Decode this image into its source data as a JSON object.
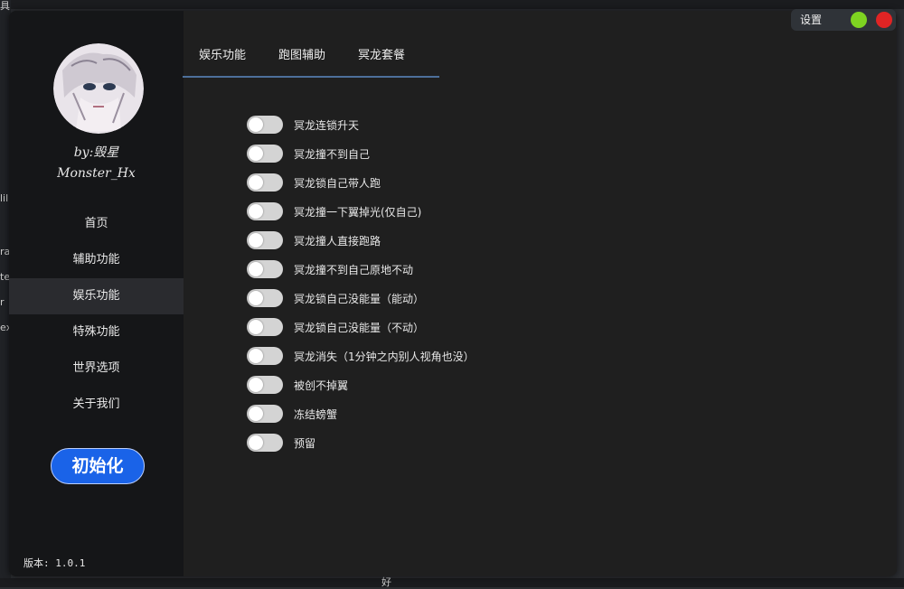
{
  "background": {
    "snippets": [
      "具",
      "lil",
      "ra",
      "te",
      "r",
      "ex",
      "好"
    ]
  },
  "sidebar": {
    "author_line1": "by:毁星",
    "author_line2": "Monster_Hx",
    "nav": [
      {
        "label": "首页"
      },
      {
        "label": "辅助功能"
      },
      {
        "label": "娱乐功能"
      },
      {
        "label": "特殊功能"
      },
      {
        "label": "世界选项"
      },
      {
        "label": "关于我们"
      }
    ],
    "active_index": 2,
    "init_button": "初始化",
    "version": "版本: 1.0.1"
  },
  "tabs": [
    {
      "label": "娱乐功能"
    },
    {
      "label": "跑图辅助"
    },
    {
      "label": "冥龙套餐"
    }
  ],
  "toggles": [
    {
      "label": "冥龙连锁升天",
      "on": false
    },
    {
      "label": "冥龙撞不到自己",
      "on": false
    },
    {
      "label": "冥龙锁自己带人跑",
      "on": false
    },
    {
      "label": "冥龙撞一下翼掉光(仅自己)",
      "on": false
    },
    {
      "label": "冥龙撞人直接跑路",
      "on": false
    },
    {
      "label": "冥龙撞不到自己原地不动",
      "on": false
    },
    {
      "label": "冥龙锁自己没能量（能动）",
      "on": false
    },
    {
      "label": "冥龙锁自己没能量（不动）",
      "on": false
    },
    {
      "label": "冥龙消失（1分钟之内别人视角也没）",
      "on": false
    },
    {
      "label": "被创不掉翼",
      "on": false
    },
    {
      "label": "冻结螃蟹",
      "on": false
    },
    {
      "label": "预留",
      "on": false
    }
  ],
  "controls": {
    "settings_label": "设置",
    "green_color": "#7ed321",
    "red_color": "#e02424"
  },
  "colors": {
    "accent": "#1a63e8",
    "tab_underline": "#4d6f9a"
  }
}
